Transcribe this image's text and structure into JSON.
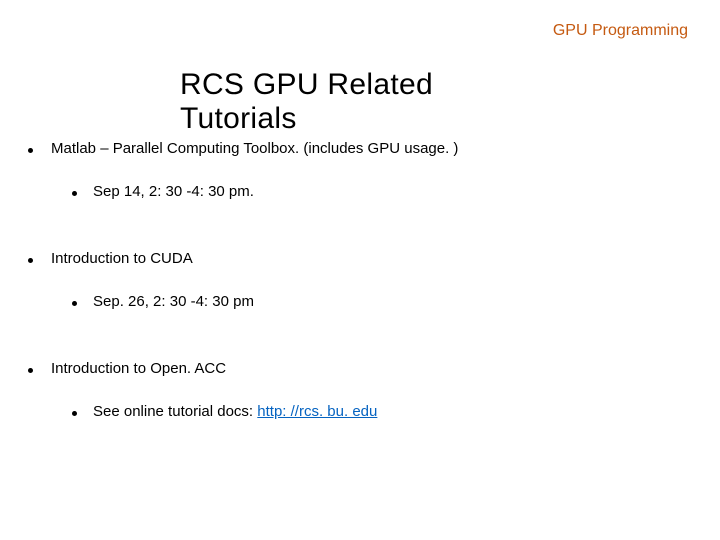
{
  "header": {
    "label": "GPU Programming"
  },
  "title": "RCS GPU Related Tutorials",
  "items": [
    {
      "text": "Matlab – Parallel Computing Toolbox.  (includes GPU usage.  )",
      "sub": "Sep 14, 2: 30 -4: 30 pm."
    },
    {
      "text": "Introduction to CUDA",
      "sub": "Sep. 26, 2: 30 -4: 30 pm"
    },
    {
      "text": "Introduction to Open. ACC",
      "sub_prefix": "See online tutorial docs:  ",
      "sub_link": "http: //rcs. bu. edu"
    }
  ]
}
